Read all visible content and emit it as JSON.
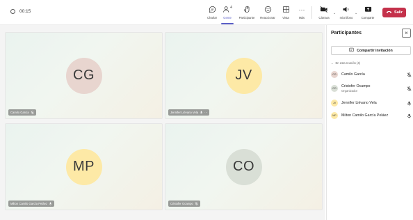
{
  "colors": {
    "accent": "#5b5fc7",
    "leave": "#c4314b",
    "avatar_cg": "#e8d5cf",
    "avatar_jv": "#fde9a6",
    "avatar_mp": "#fde9a6",
    "avatar_co": "#d9dfd6"
  },
  "meeting": {
    "timer": "00:15"
  },
  "toolbar": {
    "chat": "Charlar",
    "people": "Gente",
    "people_count": "4",
    "raise": "Participante",
    "react": "Reaccionar",
    "view": "Vista",
    "more": "Más",
    "camera": "Cámara",
    "mic": "micrófono",
    "share": "Comparte",
    "leave": "Salir"
  },
  "tiles": [
    {
      "initials": "CG",
      "name": "Camilo García"
    },
    {
      "initials": "JV",
      "name": "Jennifer Liévano Vela"
    },
    {
      "initials": "MP",
      "name": "Milton Camilo García Peláez"
    },
    {
      "initials": "CO",
      "name": "Cristofer Ocampo"
    }
  ],
  "panel": {
    "title": "Participantes",
    "invite": "Compartir invitación",
    "section": "En esta reunión (4)",
    "people": [
      {
        "initials": "CG",
        "name": "Camilo García",
        "role": "",
        "mic": "muted-mic-icon"
      },
      {
        "initials": "CO",
        "name": "Cristofer Ocampo",
        "role": "Organizador",
        "mic": "muted-mic-icon"
      },
      {
        "initials": "JV",
        "name": "Jennifer Liévano Vela",
        "role": "",
        "mic": "mic-icon"
      },
      {
        "initials": "MP",
        "name": "Milton Camilo García Peláez",
        "role": "",
        "mic": "mic-icon"
      }
    ]
  }
}
